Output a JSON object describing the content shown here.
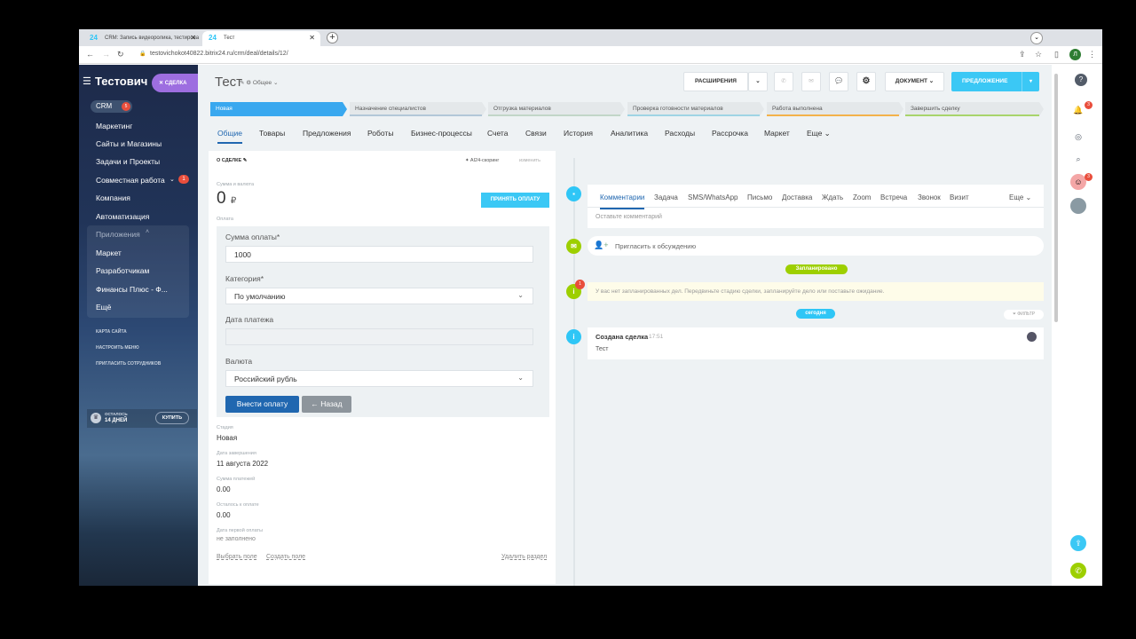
{
  "browser": {
    "tabs": [
      {
        "icon": "24",
        "label": "CRM: Запись видеоролика, тестирова"
      },
      {
        "icon": "24",
        "label": "Тест"
      }
    ],
    "url": "testovichokot40822.bitrix24.ru/crm/deal/details/12/",
    "profile": "Л"
  },
  "sidebar": {
    "title": "Тестович",
    "deal_pill": "СДЕЛКА",
    "crm": {
      "label": "CRM",
      "count": "5"
    },
    "items": [
      "Маркетинг",
      "Сайты и Магазины",
      "Задачи и Проекты",
      "Совместная работа",
      "Компания",
      "Автоматизация"
    ],
    "collab_badge": "1",
    "apps_label": "Приложения",
    "app_items": [
      "Маркет",
      "Разработчикам",
      "Финансы Плюс - Ф...",
      "Ещё"
    ],
    "small_links": [
      "КАРТА САЙТА",
      "НАСТРОИТЬ МЕНЮ",
      "ПРИГЛАСИТЬ СОТРУДНИКОВ"
    ],
    "trial": {
      "left": "ОСТАЛОСЬ",
      "days": "14 ДНЕЙ",
      "buy": "КУПИТЬ"
    }
  },
  "header": {
    "title": "Тест",
    "subtitle": "Общее",
    "extensions": "РАСШИРЕНИЯ",
    "document": "ДОКУМЕНТ",
    "proposal": "ПРЕДЛОЖЕНИЕ"
  },
  "stages": [
    "Новая",
    "Назначение специалистов",
    "Отгрузка материалов",
    "Проверка готовности материалов",
    "Работа выполнена",
    "Завершить сделку"
  ],
  "tabs": [
    "Общие",
    "Товары",
    "Предложения",
    "Роботы",
    "Бизнес-процессы",
    "Счета",
    "Связи",
    "История",
    "Аналитика",
    "Расходы",
    "Рассрочка",
    "Маркет",
    "Еще"
  ],
  "about": {
    "heading": "О СДЕЛКЕ",
    "ai": "AI24-скоринг",
    "change": "изменить",
    "sum_label": "Сумма и валюта",
    "sum_value": "0",
    "accept_btn": "ПРИНЯТЬ ОПЛАТУ",
    "payment_label": "Оплата",
    "form": {
      "amount_label": "Сумма оплаты*",
      "amount_value": "1000",
      "category_label": "Категория*",
      "category_value": "По умолчанию",
      "date_label": "Дата платежа",
      "date_value": "",
      "currency_label": "Валюта",
      "currency_value": "Российский рубль",
      "submit": "Внести оплату",
      "back": "Назад"
    },
    "fields": [
      {
        "label": "Стадия",
        "value": "Новая"
      },
      {
        "label": "Дата завершения",
        "value": "11 августа 2022"
      },
      {
        "label": "Сумма платежей",
        "value": "0.00"
      },
      {
        "label": "Осталось к оплате",
        "value": "0.00"
      },
      {
        "label": "Дата первой оплаты",
        "value": "не заполнено"
      }
    ],
    "select_field": "Выбрать поле",
    "create_field": "Создать поле",
    "delete_section": "Удалить раздел"
  },
  "timeline": {
    "tabs": [
      "Комментарии",
      "Задача",
      "SMS/WhatsApp",
      "Письмо",
      "Доставка",
      "Ждать",
      "Zoom",
      "Встреча",
      "Звонок",
      "Визит",
      "Еще"
    ],
    "comment_placeholder": "Оставьте комментарий",
    "invite": "Пригласить к обсуждению",
    "planned": "Запланировано",
    "no_plans": "У вас нет запланированных дел. Передвиньте стадию сделки, запланируйте дело или поставьте ожидание.",
    "today": "сегодня",
    "filter": "ФИЛЬТР",
    "created": "Создана сделка",
    "created_time": "17:51",
    "created_text": "Тест",
    "warn_count": "1"
  },
  "rightpanel": {
    "bell_count": "3",
    "avatar_count": "3"
  },
  "colors": {
    "accent": "#3bc8f5",
    "primary": "#2067b0",
    "planned": "#9dcf00",
    "sidebar": "#213458"
  }
}
